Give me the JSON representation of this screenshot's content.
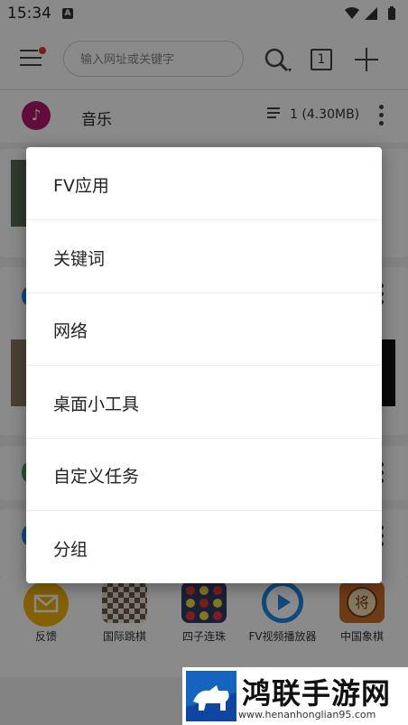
{
  "status_bar": {
    "time": "15:34",
    "notification_letter": "A"
  },
  "toolbar": {
    "search_placeholder": "输入网址或关键字",
    "tab_count": "1"
  },
  "music": {
    "title": "音乐",
    "info": "1 (4.30MB)"
  },
  "apps": [
    {
      "label": "反馈",
      "icon": "feedback-mail-icon",
      "color": "#f4b400"
    },
    {
      "label": "国际跳棋",
      "icon": "checkers-icon",
      "color": "#5d4a3a"
    },
    {
      "label": "四子连珠",
      "icon": "connect-four-icon",
      "color": "#2c3e6b"
    },
    {
      "label": "FV视频播放器",
      "icon": "video-player-icon",
      "color": "#1e88e5"
    },
    {
      "label": "中国象棋",
      "icon": "chinese-chess-icon",
      "color": "#c8702a"
    }
  ],
  "popup_menu": {
    "items": [
      {
        "label": "FV应用"
      },
      {
        "label": "关键词"
      },
      {
        "label": "网络"
      },
      {
        "label": "桌面小工具"
      },
      {
        "label": "自定义任务"
      },
      {
        "label": "分组"
      }
    ]
  },
  "watermark": {
    "title": "鸿联手游网",
    "url": "www.henanhonglian95.com"
  },
  "colors": {
    "music_icon": "#b5176d",
    "scrim": "rgba(0,0,0,0.46)",
    "watermark_blue": "#1565c0"
  }
}
